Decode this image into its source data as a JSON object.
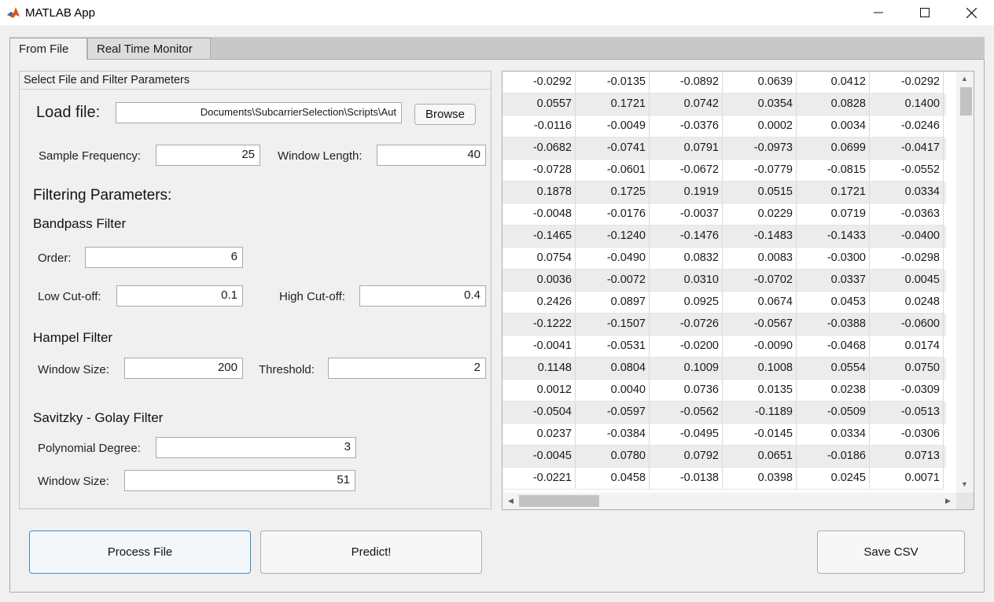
{
  "window": {
    "title": "MATLAB App"
  },
  "tabs": [
    {
      "label": "From File"
    },
    {
      "label": "Real Time Monitor"
    }
  ],
  "panel": {
    "title": "Select File and Filter Parameters",
    "load_file_label": "Load file:",
    "file_path_value": "Documents\\SubcarrierSelection\\Scripts\\Aut",
    "browse_label": "Browse",
    "sample_frequency_label": "Sample Frequency:",
    "sample_frequency_value": "25",
    "window_length_label": "Window Length:",
    "window_length_value": "40",
    "filtering_heading": "Filtering Parameters:",
    "bandpass": {
      "heading": "Bandpass Filter",
      "order_label": "Order:",
      "order_value": "6",
      "low_cutoff_label": "Low Cut-off:",
      "low_cutoff_value": "0.1",
      "high_cutoff_label": "High Cut-off:",
      "high_cutoff_value": "0.4"
    },
    "hampel": {
      "heading": "Hampel Filter",
      "window_size_label": "Window Size:",
      "window_size_value": "200",
      "threshold_label": "Threshold:",
      "threshold_value": "2"
    },
    "savitzky": {
      "heading": "Savitzky - Golay Filter",
      "poly_degree_label": "Polynomial Degree:",
      "poly_degree_value": "3",
      "window_size_label": "Window Size:",
      "window_size_value": "51"
    }
  },
  "buttons": {
    "process": "Process File",
    "predict": "Predict!",
    "save": "Save CSV"
  },
  "table": {
    "rows": [
      [
        "-0.0292",
        "-0.0135",
        "-0.0892",
        "0.0639",
        "0.0412",
        "-0.0292"
      ],
      [
        "0.0557",
        "0.1721",
        "0.0742",
        "0.0354",
        "0.0828",
        "0.1400"
      ],
      [
        "-0.0116",
        "-0.0049",
        "-0.0376",
        "0.0002",
        "0.0034",
        "-0.0246"
      ],
      [
        "-0.0682",
        "-0.0741",
        "0.0791",
        "-0.0973",
        "0.0699",
        "-0.0417"
      ],
      [
        "-0.0728",
        "-0.0601",
        "-0.0672",
        "-0.0779",
        "-0.0815",
        "-0.0552"
      ],
      [
        "0.1878",
        "0.1725",
        "0.1919",
        "0.0515",
        "0.1721",
        "0.0334"
      ],
      [
        "-0.0048",
        "-0.0176",
        "-0.0037",
        "0.0229",
        "0.0719",
        "-0.0363"
      ],
      [
        "-0.1465",
        "-0.1240",
        "-0.1476",
        "-0.1483",
        "-0.1433",
        "-0.0400"
      ],
      [
        "0.0754",
        "-0.0490",
        "0.0832",
        "0.0083",
        "-0.0300",
        "-0.0298"
      ],
      [
        "0.0036",
        "-0.0072",
        "0.0310",
        "-0.0702",
        "0.0337",
        "0.0045"
      ],
      [
        "0.2426",
        "0.0897",
        "0.0925",
        "0.0674",
        "0.0453",
        "0.0248"
      ],
      [
        "-0.1222",
        "-0.1507",
        "-0.0726",
        "-0.0567",
        "-0.0388",
        "-0.0600"
      ],
      [
        "-0.0041",
        "-0.0531",
        "-0.0200",
        "-0.0090",
        "-0.0468",
        "0.0174"
      ],
      [
        "0.1148",
        "0.0804",
        "0.1009",
        "0.1008",
        "0.0554",
        "0.0750"
      ],
      [
        "0.0012",
        "0.0040",
        "0.0736",
        "0.0135",
        "0.0238",
        "-0.0309"
      ],
      [
        "-0.0504",
        "-0.0597",
        "-0.0562",
        "-0.1189",
        "-0.0509",
        "-0.0513"
      ],
      [
        "0.0237",
        "-0.0384",
        "-0.0495",
        "-0.0145",
        "0.0334",
        "-0.0306"
      ],
      [
        "-0.0045",
        "0.0780",
        "0.0792",
        "0.0651",
        "-0.0186",
        "0.0713"
      ],
      [
        "-0.0221",
        "0.0458",
        "-0.0138",
        "0.0398",
        "0.0245",
        "0.0071"
      ]
    ]
  },
  "colors": {
    "accent_border": "#3c8fc4",
    "tab_strip": "#c8c8c8",
    "app_icon": "#d9541e"
  }
}
